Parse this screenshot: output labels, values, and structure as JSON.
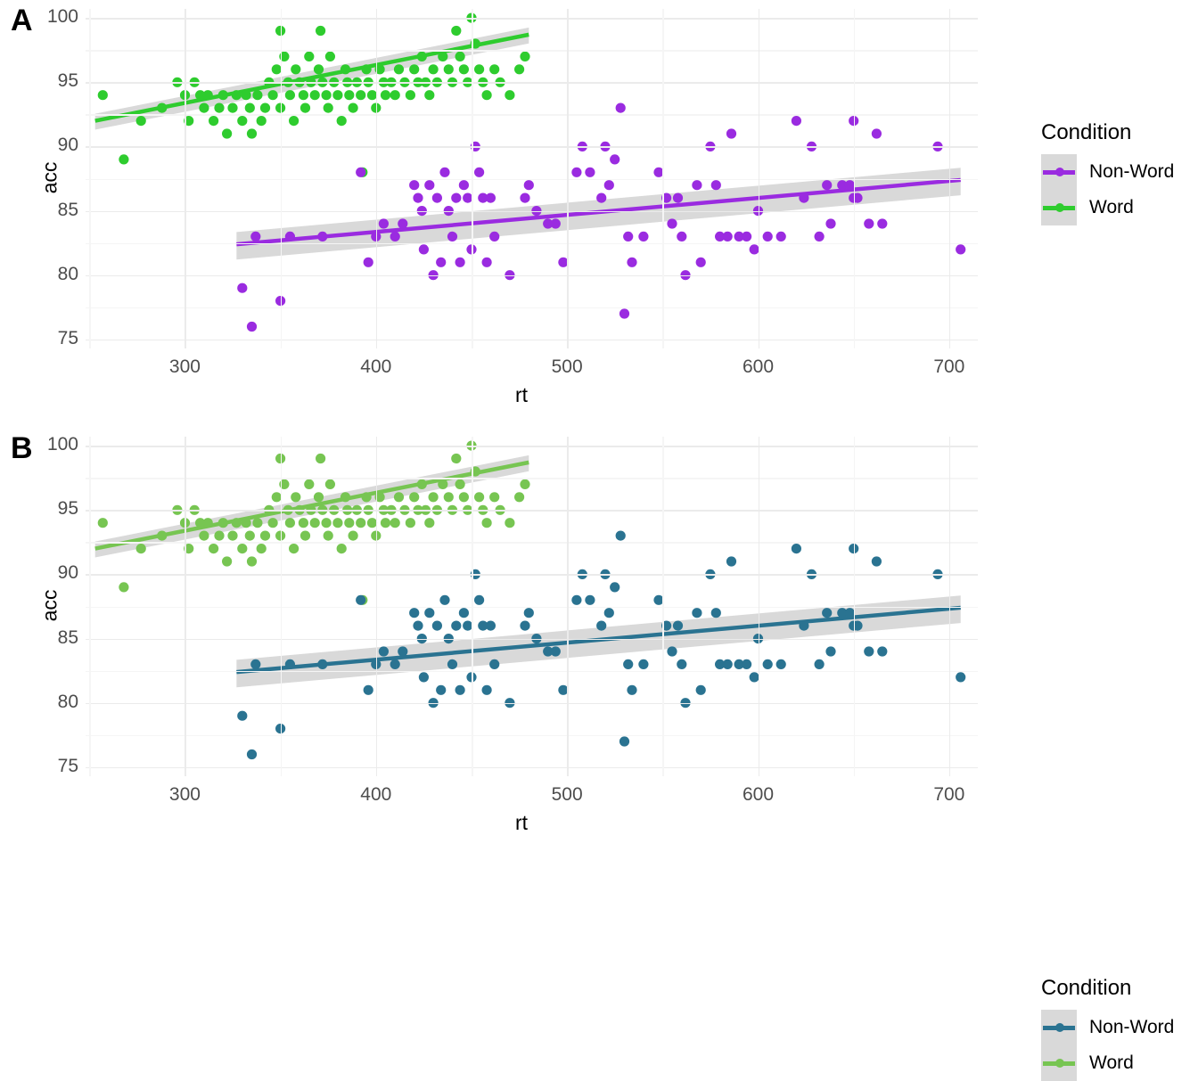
{
  "figure": {
    "panels": [
      {
        "tag": "A",
        "xlabel": "rt",
        "ylabel": "acc",
        "legend_title": "Condition",
        "colors": {
          "non_word": "#9A2BE0",
          "word": "#2ECC2E",
          "band": "#d9d9d9",
          "grid_major": "#ebebeb",
          "grid_minor": "#f5f5f5"
        }
      },
      {
        "tag": "B",
        "xlabel": "rt",
        "ylabel": "acc",
        "legend_title": "Condition",
        "colors": {
          "non_word": "#2A7391",
          "word": "#77C552",
          "band": "#d9d9d9",
          "grid_major": "#ebebeb",
          "grid_minor": "#f5f5f5"
        }
      }
    ],
    "axis": {
      "x_ticks": [
        "300",
        "400",
        "500",
        "600",
        "700"
      ],
      "y_ticks": [
        "75",
        "80",
        "85",
        "90",
        "95",
        "100"
      ]
    },
    "legend_labels": [
      "Non-Word",
      "Word"
    ]
  },
  "chart_data": {
    "type": "scatter",
    "title": "",
    "subtitle": "",
    "xlabel": "rt",
    "ylabel": "acc",
    "xlim": [
      248,
      715
    ],
    "ylim": [
      74.3,
      100.7
    ],
    "x_ticks": [
      300,
      400,
      500,
      600,
      700
    ],
    "y_ticks": [
      75,
      80,
      85,
      90,
      95,
      100
    ],
    "grid": true,
    "legend_title": "Condition",
    "legend_position": "right",
    "panel_labels": [
      "A",
      "B"
    ],
    "note": "Panels A and B plot identical data with different colour palettes (A: purple/green, B: teal/light-green).",
    "series": [
      {
        "name": "Word",
        "color_panel_a": "#2ECC2E",
        "color_panel_b": "#77C552",
        "points": [
          [
            257,
            94
          ],
          [
            268,
            89
          ],
          [
            277,
            92
          ],
          [
            288,
            93
          ],
          [
            296,
            95
          ],
          [
            300,
            94
          ],
          [
            302,
            92
          ],
          [
            305,
            95
          ],
          [
            308,
            94
          ],
          [
            310,
            93
          ],
          [
            312,
            94
          ],
          [
            315,
            92
          ],
          [
            318,
            93
          ],
          [
            320,
            94
          ],
          [
            322,
            91
          ],
          [
            325,
            93
          ],
          [
            327,
            94
          ],
          [
            330,
            92
          ],
          [
            332,
            94
          ],
          [
            334,
            93
          ],
          [
            335,
            91
          ],
          [
            338,
            94
          ],
          [
            340,
            92
          ],
          [
            342,
            93
          ],
          [
            344,
            95
          ],
          [
            346,
            94
          ],
          [
            348,
            96
          ],
          [
            350,
            99
          ],
          [
            350,
            93
          ],
          [
            352,
            97
          ],
          [
            354,
            95
          ],
          [
            355,
            94
          ],
          [
            357,
            92
          ],
          [
            358,
            96
          ],
          [
            360,
            95
          ],
          [
            362,
            94
          ],
          [
            363,
            93
          ],
          [
            365,
            97
          ],
          [
            366,
            95
          ],
          [
            368,
            94
          ],
          [
            370,
            96
          ],
          [
            371,
            99
          ],
          [
            372,
            95
          ],
          [
            374,
            94
          ],
          [
            375,
            93
          ],
          [
            376,
            97
          ],
          [
            378,
            95
          ],
          [
            380,
            94
          ],
          [
            382,
            92
          ],
          [
            384,
            96
          ],
          [
            385,
            95
          ],
          [
            386,
            94
          ],
          [
            388,
            93
          ],
          [
            390,
            95
          ],
          [
            392,
            94
          ],
          [
            393,
            88
          ],
          [
            395,
            96
          ],
          [
            396,
            95
          ],
          [
            398,
            94
          ],
          [
            400,
            93
          ],
          [
            402,
            96
          ],
          [
            404,
            95
          ],
          [
            405,
            94
          ],
          [
            408,
            95
          ],
          [
            410,
            94
          ],
          [
            412,
            96
          ],
          [
            415,
            95
          ],
          [
            418,
            94
          ],
          [
            420,
            96
          ],
          [
            422,
            95
          ],
          [
            424,
            97
          ],
          [
            426,
            95
          ],
          [
            428,
            94
          ],
          [
            430,
            96
          ],
          [
            432,
            95
          ],
          [
            435,
            97
          ],
          [
            438,
            96
          ],
          [
            440,
            95
          ],
          [
            442,
            99
          ],
          [
            444,
            97
          ],
          [
            446,
            96
          ],
          [
            448,
            95
          ],
          [
            450,
            100
          ],
          [
            452,
            98
          ],
          [
            454,
            96
          ],
          [
            456,
            95
          ],
          [
            458,
            94
          ],
          [
            462,
            96
          ],
          [
            465,
            95
          ],
          [
            470,
            94
          ],
          [
            475,
            96
          ],
          [
            478,
            97
          ]
        ],
        "fit": {
          "x_start": 253,
          "x_end": 480,
          "y_start": 92.0,
          "y_end": 98.7,
          "band_half_width_y": 0.55
        }
      },
      {
        "name": "Non-Word",
        "color_panel_a": "#9A2BE0",
        "color_panel_b": "#2A7391",
        "points": [
          [
            330,
            79
          ],
          [
            335,
            76
          ],
          [
            337,
            83
          ],
          [
            350,
            78
          ],
          [
            355,
            83
          ],
          [
            372,
            83
          ],
          [
            392,
            88
          ],
          [
            396,
            81
          ],
          [
            400,
            83
          ],
          [
            404,
            84
          ],
          [
            410,
            83
          ],
          [
            414,
            84
          ],
          [
            420,
            87
          ],
          [
            422,
            86
          ],
          [
            424,
            85
          ],
          [
            425,
            82
          ],
          [
            428,
            87
          ],
          [
            430,
            80
          ],
          [
            432,
            86
          ],
          [
            434,
            81
          ],
          [
            436,
            88
          ],
          [
            438,
            85
          ],
          [
            440,
            83
          ],
          [
            442,
            86
          ],
          [
            444,
            81
          ],
          [
            446,
            87
          ],
          [
            448,
            86
          ],
          [
            450,
            82
          ],
          [
            452,
            90
          ],
          [
            454,
            88
          ],
          [
            456,
            86
          ],
          [
            458,
            81
          ],
          [
            460,
            86
          ],
          [
            462,
            83
          ],
          [
            470,
            80
          ],
          [
            478,
            86
          ],
          [
            480,
            87
          ],
          [
            484,
            85
          ],
          [
            490,
            84
          ],
          [
            494,
            84
          ],
          [
            498,
            81
          ],
          [
            505,
            88
          ],
          [
            508,
            90
          ],
          [
            512,
            88
          ],
          [
            518,
            86
          ],
          [
            520,
            90
          ],
          [
            522,
            87
          ],
          [
            525,
            89
          ],
          [
            528,
            93
          ],
          [
            530,
            77
          ],
          [
            532,
            83
          ],
          [
            534,
            81
          ],
          [
            540,
            83
          ],
          [
            548,
            88
          ],
          [
            552,
            86
          ],
          [
            555,
            84
          ],
          [
            558,
            86
          ],
          [
            560,
            83
          ],
          [
            562,
            80
          ],
          [
            568,
            87
          ],
          [
            570,
            81
          ],
          [
            575,
            90
          ],
          [
            578,
            87
          ],
          [
            580,
            83
          ],
          [
            584,
            83
          ],
          [
            586,
            91
          ],
          [
            590,
            83
          ],
          [
            594,
            83
          ],
          [
            598,
            82
          ],
          [
            600,
            85
          ],
          [
            605,
            83
          ],
          [
            612,
            83
          ],
          [
            620,
            92
          ],
          [
            624,
            86
          ],
          [
            628,
            90
          ],
          [
            632,
            83
          ],
          [
            636,
            87
          ],
          [
            638,
            84
          ],
          [
            644,
            87
          ],
          [
            648,
            87
          ],
          [
            650,
            92
          ],
          [
            650,
            86
          ],
          [
            652,
            86
          ],
          [
            658,
            84
          ],
          [
            662,
            91
          ],
          [
            665,
            84
          ],
          [
            694,
            90
          ],
          [
            706,
            82
          ]
        ],
        "fit": {
          "x_start": 327,
          "x_end": 706,
          "y_start": 82.4,
          "y_end": 87.4,
          "band_half_width_y": 0.95
        }
      }
    ]
  }
}
